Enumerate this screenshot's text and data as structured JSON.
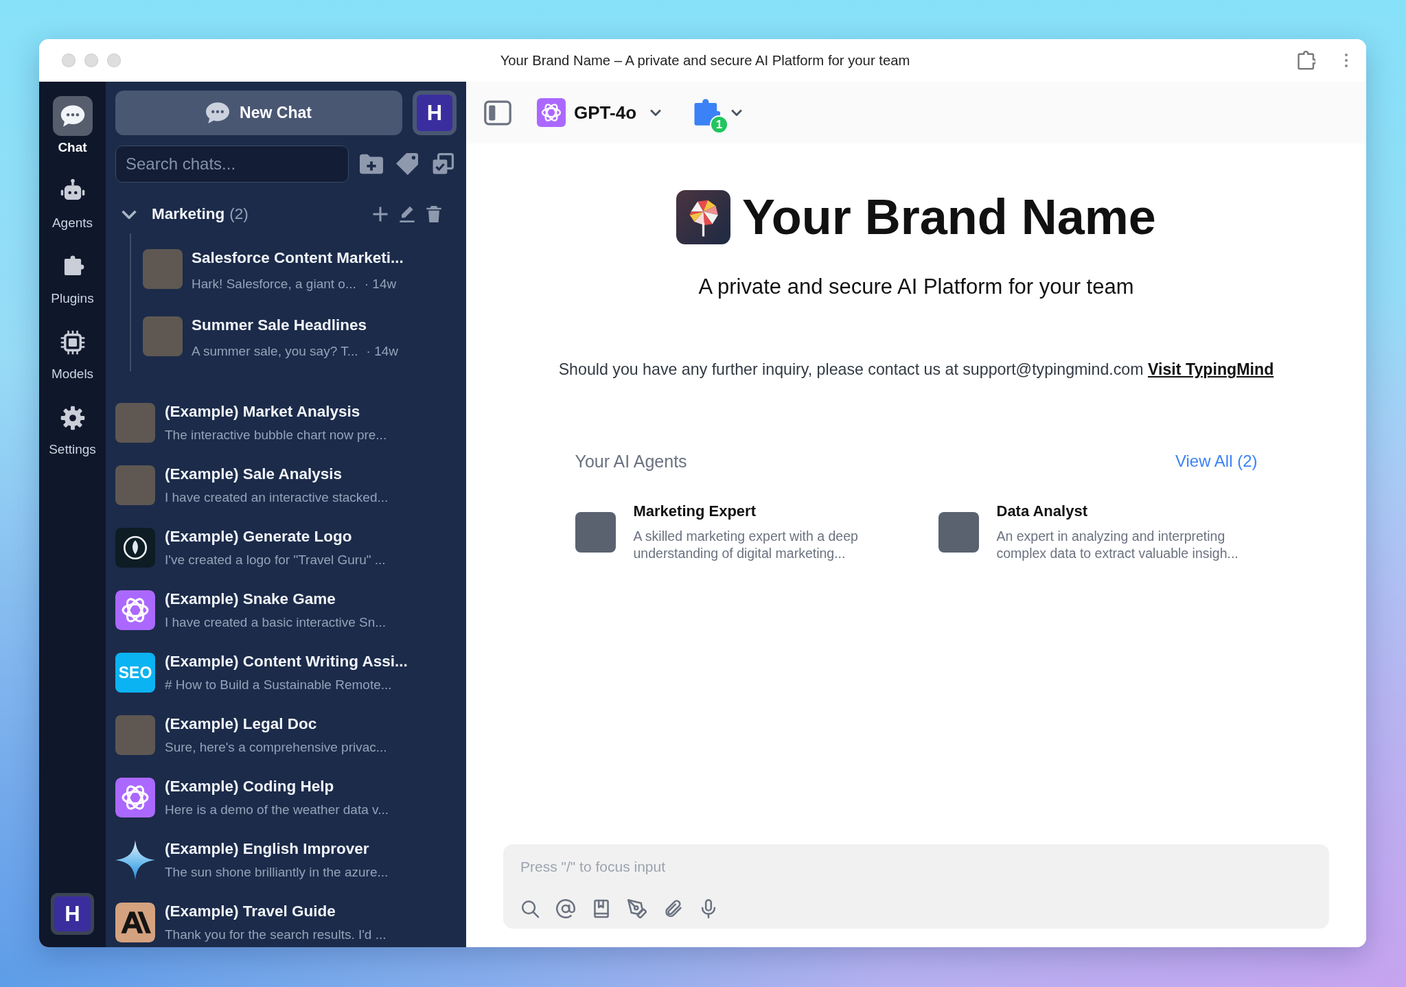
{
  "window": {
    "title": "Your Brand Name – A private and secure AI Platform for your team"
  },
  "nav": {
    "items": [
      {
        "label": "Chat",
        "selected": true
      },
      {
        "label": "Agents",
        "selected": false
      },
      {
        "label": "Plugins",
        "selected": false
      },
      {
        "label": "Models",
        "selected": false
      },
      {
        "label": "Settings",
        "selected": false
      }
    ],
    "avatar": "H"
  },
  "sidebar": {
    "new_chat": "New Chat",
    "workspace": "H",
    "search": {
      "placeholder": "Search chats..."
    },
    "folders": [
      {
        "name": "Marketing",
        "count": "(2)",
        "expanded": true,
        "chats": [
          {
            "title": "Salesforce Content Marketi...",
            "preview": "Hark! Salesforce, a giant o...",
            "time": "· 14w",
            "avatar": {
              "kind": "photo"
            }
          },
          {
            "title": "Summer Sale Headlines",
            "preview": "A summer sale, you say? T...",
            "time": "· 14w",
            "avatar": {
              "kind": "photo"
            }
          }
        ]
      }
    ],
    "chats": [
      {
        "title": "(Example) Market Analysis",
        "preview": "The interactive bubble chart now pre...",
        "avatar": {
          "kind": "photo"
        }
      },
      {
        "title": "(Example) Sale Analysis",
        "preview": "I have created an interactive stacked...",
        "avatar": {
          "kind": "photo"
        }
      },
      {
        "title": "(Example) Generate Logo",
        "preview": "I've created a logo for \"Travel Guru\" ...",
        "avatar": {
          "kind": "emblem"
        }
      },
      {
        "title": "(Example) Snake Game",
        "preview": "I have created a basic interactive Sn...",
        "avatar": {
          "kind": "knot"
        }
      },
      {
        "title": "(Example) Content Writing Assi...",
        "preview": "# How to Build a Sustainable Remote...",
        "avatar": {
          "kind": "text",
          "text": "SEO"
        }
      },
      {
        "title": "(Example) Legal Doc",
        "preview": "Sure, here's a comprehensive privac...",
        "avatar": {
          "kind": "photo"
        }
      },
      {
        "title": "(Example) Coding Help",
        "preview": "Here is a demo of the weather data v...",
        "avatar": {
          "kind": "knot"
        }
      },
      {
        "title": "(Example) English Improver",
        "preview": "The sun shone brilliantly in the azure...",
        "avatar": {
          "kind": "star"
        }
      },
      {
        "title": "(Example) Travel Guide",
        "preview": "Thank you for the search results. I'd ...",
        "avatar": {
          "kind": "mark"
        }
      }
    ]
  },
  "toolbar": {
    "model": "GPT-4o",
    "plugin_badge": "1"
  },
  "hero": {
    "brand": "Your Brand Name",
    "tagline": "A private and secure AI Platform for your team",
    "contact": "Should you have any further inquiry, please contact us at support@typingmind.com",
    "link": "Visit TypingMind"
  },
  "agents": {
    "title": "Your AI Agents",
    "view_all": "View All (2)",
    "items": [
      {
        "name": "Marketing Expert",
        "description": "A skilled marketing expert with a deep understanding of digital marketing..."
      },
      {
        "name": "Data Analyst",
        "description": "An expert in analyzing and interpreting complex data to extract valuable insigh..."
      }
    ]
  },
  "composer": {
    "placeholder": "Press \"/\" to focus input"
  }
}
